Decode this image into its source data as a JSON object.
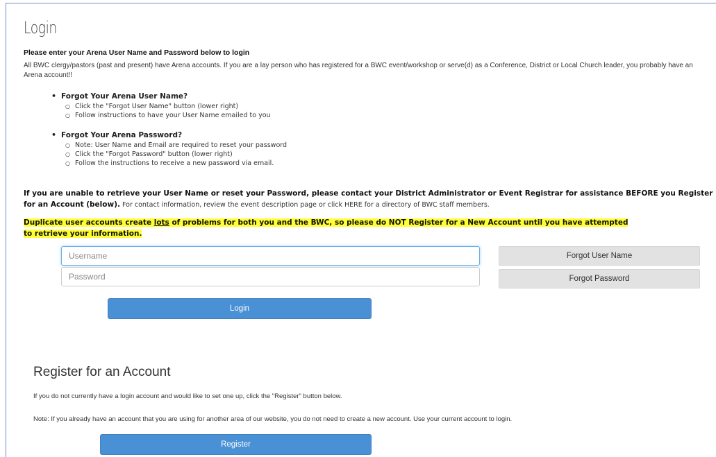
{
  "login": {
    "title": "Login",
    "subhead": "Please enter your Arena User Name and Password below to login",
    "intro": "All BWC clergy/pastors (past and present) have Arena accounts. If you are a lay person who has registered for a BWC event/workshop or serve(d) as a Conference, District or Local Church leader, you probably have an Arena account!!",
    "help": [
      {
        "heading": "Forgot Your Arena User Name?",
        "steps": [
          "Click the \"Forgot User Name\" button (lower right)",
          "Follow instructions to have your User Name emailed to you"
        ]
      },
      {
        "heading": "Forgot Your Arena Password?",
        "steps": [
          "Note: User Name and Email are required to reset your password",
          "Click the \"Forgot Password\" button (lower right)",
          "Follow the instructions to receive a new password via email."
        ]
      }
    ],
    "warning_bold": "If you are unable to retrieve your User Name or reset your Password, please contact your District Administrator or Event Registrar for assistance BEFORE you Register for an Account (below).",
    "warning_rest": " For contact information, review the event description page or click ",
    "warning_link": "HERE",
    "warning_tail": " for a directory of BWC staff members.",
    "highlight_pre": "Duplicate user accounts create ",
    "highlight_underlined": "lots",
    "highlight_post_line1": " of problems for both you and the BWC, so please do NOT Register for a New Account until you have attempted",
    "highlight_line2": "to retrieve your information.",
    "username_placeholder": "Username",
    "password_placeholder": "Password",
    "forgot_username_label": "Forgot User Name",
    "forgot_password_label": "Forgot Password",
    "login_button_label": "Login"
  },
  "register": {
    "title": "Register for an Account",
    "text1": "If you do not currently have a login account and would like to set one up, click the \"Register\" button below.",
    "text2": "Note: If you already have an account that you are using for another area of our website, you do not need to create a new account. Use your current account to login.",
    "button_label": "Register"
  },
  "colors": {
    "primary_button": "#4a90d4",
    "secondary_button": "#e2e2e2",
    "highlight": "#ffff33",
    "link": "#3a7bd5"
  }
}
